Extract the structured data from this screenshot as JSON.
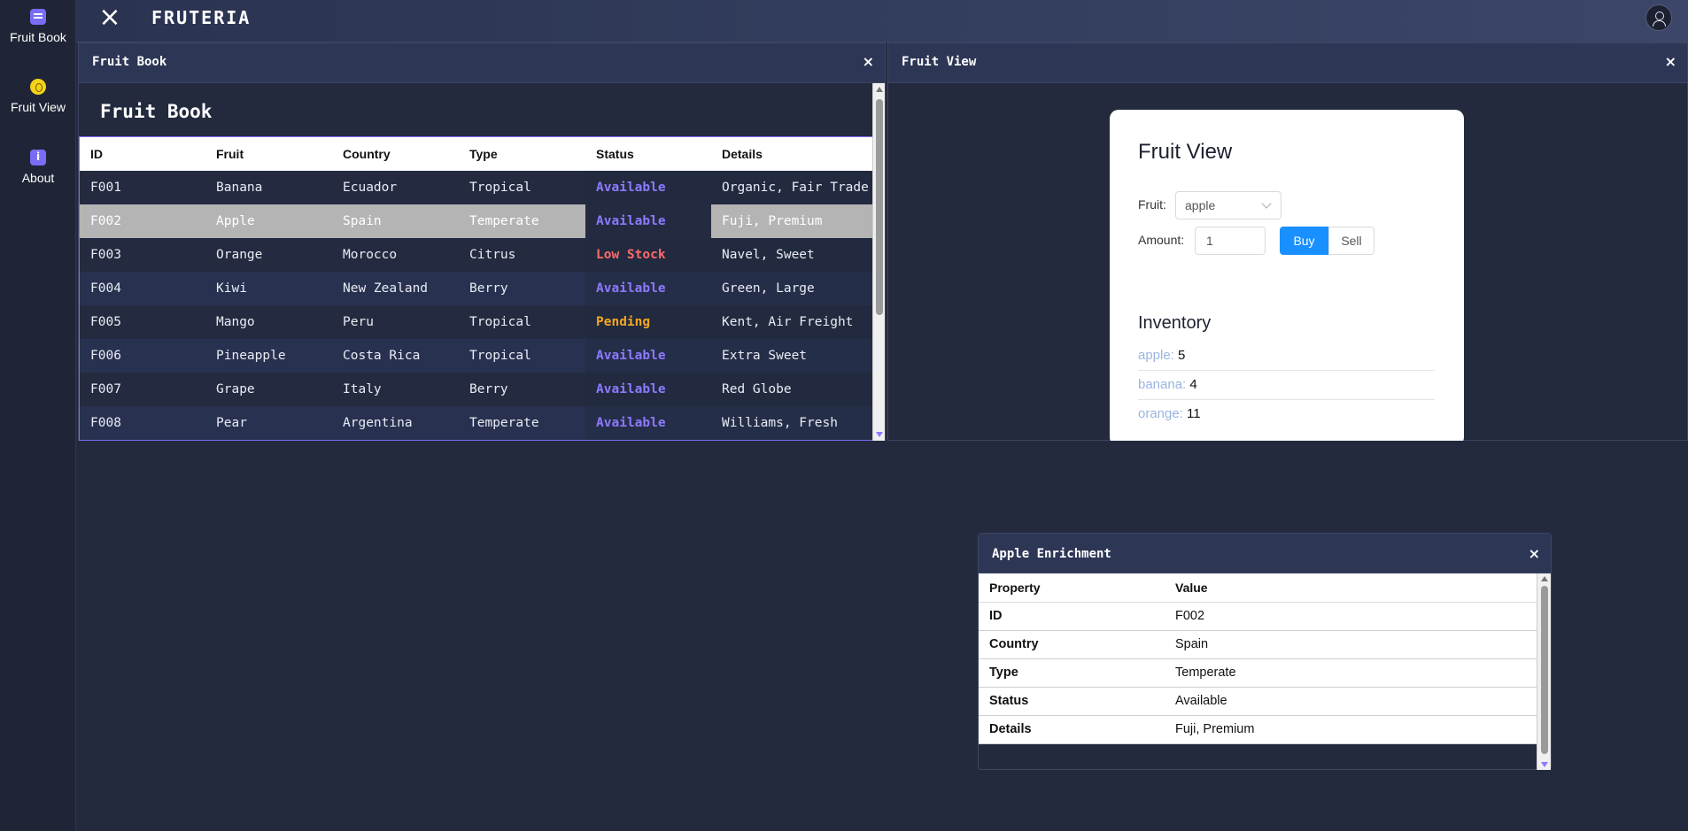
{
  "sidebar": {
    "items": [
      {
        "label": "Fruit Book",
        "icon": "book-icon"
      },
      {
        "label": "Fruit View",
        "icon": "fruit-icon"
      },
      {
        "label": "About",
        "icon": "info-icon"
      }
    ]
  },
  "topbar": {
    "close_icon": "×",
    "brand": "FRUTERIA"
  },
  "fruit_book": {
    "panel_title": "Fruit Book",
    "close": "×",
    "heading": "Fruit Book",
    "columns": [
      "ID",
      "Fruit",
      "Country",
      "Type",
      "Status",
      "Details"
    ],
    "rows": [
      {
        "id": "F001",
        "fruit": "Banana",
        "country": "Ecuador",
        "type": "Tropical",
        "status": "Available",
        "details": "Organic, Fair Trade"
      },
      {
        "id": "F002",
        "fruit": "Apple",
        "country": "Spain",
        "type": "Temperate",
        "status": "Available",
        "details": "Fuji, Premium"
      },
      {
        "id": "F003",
        "fruit": "Orange",
        "country": "Morocco",
        "type": "Citrus",
        "status": "Low Stock",
        "details": "Navel, Sweet"
      },
      {
        "id": "F004",
        "fruit": "Kiwi",
        "country": "New Zealand",
        "type": "Berry",
        "status": "Available",
        "details": "Green, Large"
      },
      {
        "id": "F005",
        "fruit": "Mango",
        "country": "Peru",
        "type": "Tropical",
        "status": "Pending",
        "details": "Kent, Air Freight"
      },
      {
        "id": "F006",
        "fruit": "Pineapple",
        "country": "Costa Rica",
        "type": "Tropical",
        "status": "Available",
        "details": "Extra Sweet"
      },
      {
        "id": "F007",
        "fruit": "Grape",
        "country": "Italy",
        "type": "Berry",
        "status": "Available",
        "details": "Red Globe"
      },
      {
        "id": "F008",
        "fruit": "Pear",
        "country": "Argentina",
        "type": "Temperate",
        "status": "Available",
        "details": "Williams, Fresh"
      }
    ],
    "selected_id": "F002"
  },
  "fruit_view": {
    "panel_title": "Fruit View",
    "close": "×",
    "title": "Fruit View",
    "fruit_label": "Fruit:",
    "fruit_value": "apple",
    "amount_label": "Amount:",
    "amount_value": "1",
    "buy_label": "Buy",
    "sell_label": "Sell",
    "inventory_title": "Inventory",
    "inventory": [
      {
        "name": "apple:",
        "count": "5"
      },
      {
        "name": "banana:",
        "count": "4"
      },
      {
        "name": "orange:",
        "count": "11"
      }
    ]
  },
  "enrichment": {
    "panel_title": "Apple Enrichment",
    "close": "×",
    "columns": [
      "Property",
      "Value"
    ],
    "rows": [
      {
        "property": "ID",
        "value": "F002"
      },
      {
        "property": "Country",
        "value": "Spain"
      },
      {
        "property": "Type",
        "value": "Temperate"
      },
      {
        "property": "Status",
        "value": "Available"
      },
      {
        "property": "Details",
        "value": "Fuji, Premium"
      }
    ]
  },
  "colors": {
    "accent": "#7b6cf6",
    "available": "#8d79ff",
    "low_stock": "#ff6b6b",
    "pending": "#f5a623",
    "buy_button": "#1890ff",
    "background": "#232a3e"
  }
}
